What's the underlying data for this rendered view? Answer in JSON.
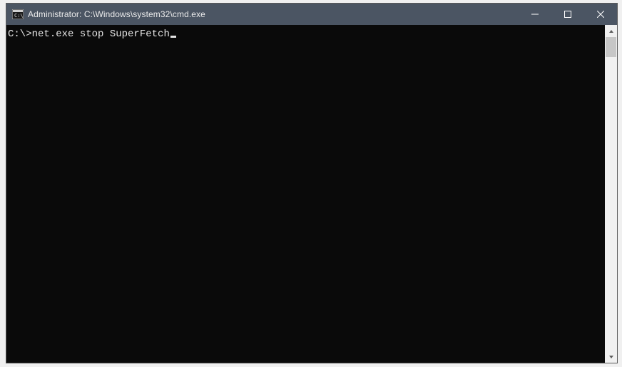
{
  "window": {
    "title": "Administrator: C:\\Windows\\system32\\cmd.exe"
  },
  "terminal": {
    "prompt": "C:\\>",
    "command": "net.exe stop SuperFetch"
  }
}
